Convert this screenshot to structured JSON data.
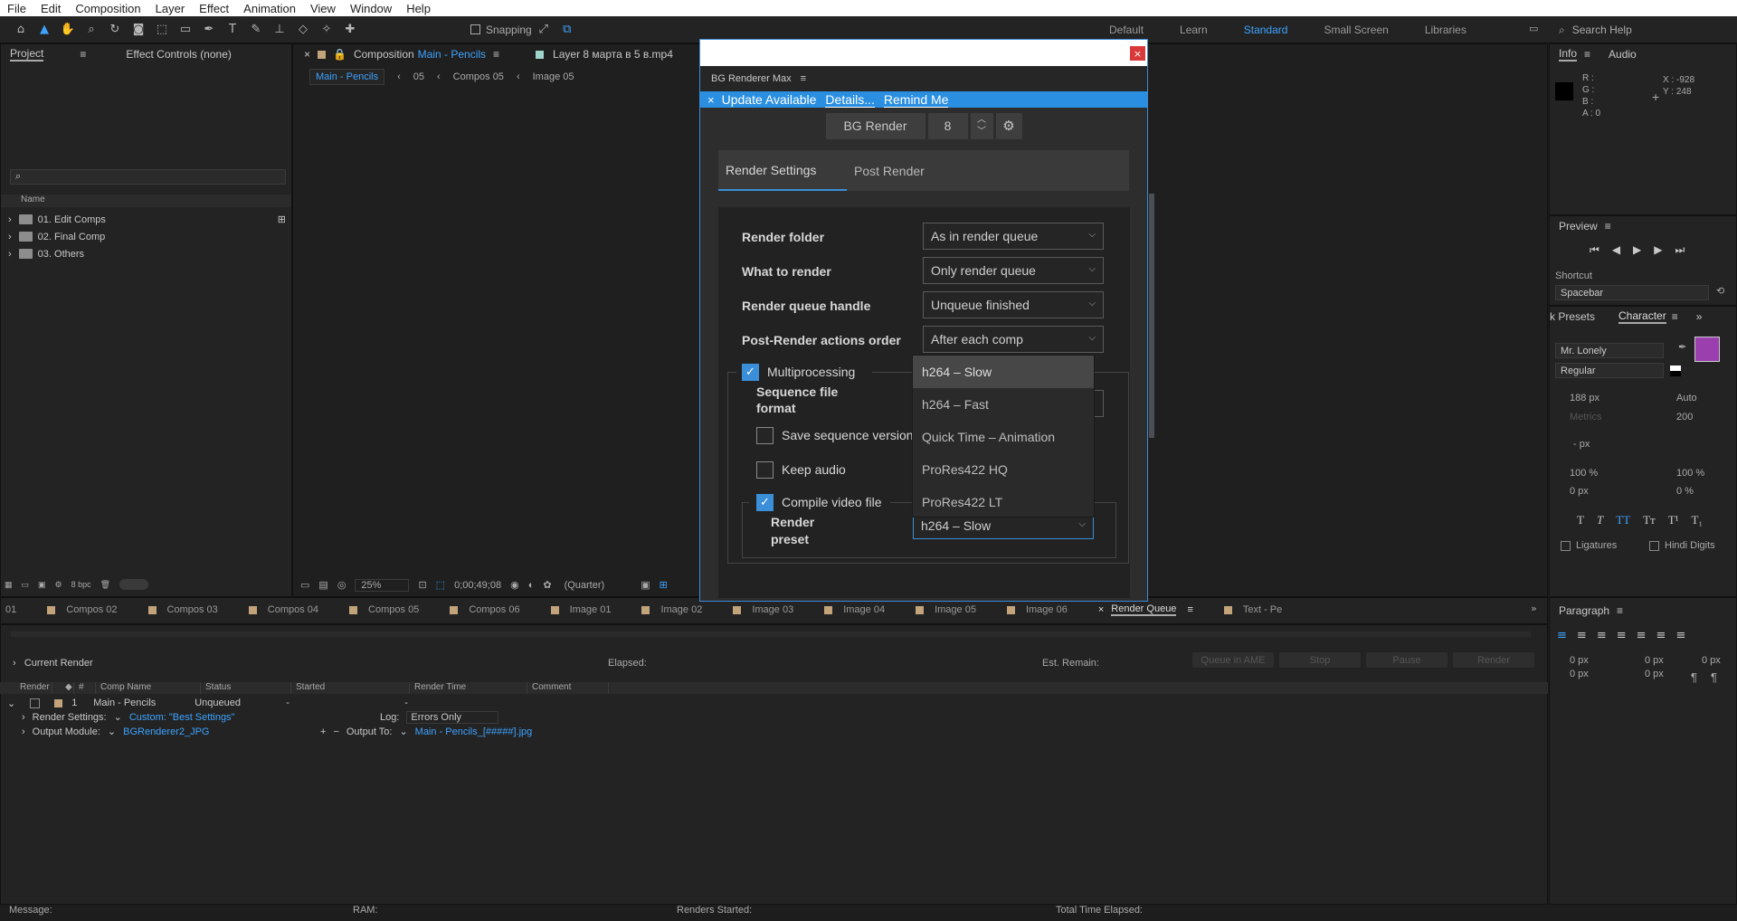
{
  "menu": [
    "File",
    "Edit",
    "Composition",
    "Layer",
    "Effect",
    "Animation",
    "View",
    "Window",
    "Help"
  ],
  "toolbar": {
    "snapping": "Snapping"
  },
  "workspaces": {
    "items": [
      "Default",
      "Learn",
      "Standard",
      "Small Screen",
      "Libraries"
    ],
    "selected": "Standard",
    "search_placeholder": "Search Help"
  },
  "project": {
    "tab_project": "Project",
    "tab_effect": "Effect Controls (none)",
    "search_placeholder": "",
    "col_name": "Name",
    "folders": [
      "01. Edit Comps",
      "02. Final Comp",
      "03. Others"
    ],
    "bpc": "8 bpc"
  },
  "composition": {
    "tab_label": "Composition",
    "comp_name": "Main - Pencils",
    "layer_tab": "Layer  8 марта в 5 в.mp4",
    "crumbs": [
      "Main - Pencils",
      "05",
      "Compos 05",
      "Image 05"
    ],
    "zoom": "25%",
    "timecode": "0;00;49;08",
    "quality": "(Quarter)"
  },
  "dialog": {
    "title": "BG Renderer Max",
    "update": {
      "text": "Update Available",
      "details": "Details...",
      "remind": "Remind Me"
    },
    "bg_render": "BG Render",
    "count": "8",
    "tabs": [
      "Render Settings",
      "Post Render"
    ],
    "rows": [
      {
        "label": "Render folder",
        "value": "As in render queue"
      },
      {
        "label": "What to render",
        "value": "Only render queue"
      },
      {
        "label": "Render queue handle",
        "value": "Unqueue finished"
      },
      {
        "label": "Post-Render actions order",
        "value": "After each comp"
      }
    ],
    "multiprocessing": "Multiprocessing",
    "seq_format_1": "Sequence file",
    "seq_format_2": "format",
    "save_seq": "Save sequence version",
    "keep_audio": "Keep audio",
    "compile": "Compile video file",
    "render_preset_1": "Render",
    "render_preset_2": "preset",
    "preset_value": "h264 – Slow",
    "dropdown": [
      "h264 – Slow",
      "h264 – Fast",
      "Quick Time – Animation",
      "ProRes422 HQ",
      "ProRes422 LT"
    ]
  },
  "bottom_tabs": [
    "01",
    "Compos 02",
    "Compos 03",
    "Compos 04",
    "Compos 05",
    "Compos 06",
    "Image 01",
    "Image 02",
    "Image 03",
    "Image 04",
    "Image 05",
    "Image 06",
    "Render Queue",
    "Text - Pe"
  ],
  "render_queue": {
    "current_render": "Current Render",
    "elapsed": "Elapsed:",
    "est_remain": "Est. Remain:",
    "buttons": [
      "Queue in AME",
      "Stop",
      "Pause",
      "Render"
    ],
    "headers": [
      "Render",
      "#",
      "Comp Name",
      "Status",
      "Started",
      "Render Time",
      "Comment"
    ],
    "item": {
      "num": "1",
      "comp": "Main - Pencils",
      "status": "Unqueued",
      "started": "-",
      "render_time": "-"
    },
    "render_settings_label": "Render Settings:",
    "render_settings_value": "Custom: \"Best Settings\"",
    "log_label": "Log:",
    "log_value": "Errors Only",
    "output_module_label": "Output Module:",
    "output_module_value": "BGRenderer2_JPG",
    "output_to_label": "Output To:",
    "output_to_value": "Main - Pencils_[#####].jpg"
  },
  "status_bar": {
    "message": "Message:",
    "ram": "RAM:",
    "renders_started": "Renders Started:",
    "total_time": "Total Time Elapsed:"
  },
  "info": {
    "tab_info": "Info",
    "tab_audio": "Audio",
    "r": "R :",
    "g": "G :",
    "b": "B :",
    "a": "A :  0",
    "x": "X : -928",
    "y": "Y : 248"
  },
  "preview": {
    "title": "Preview",
    "shortcut_label": "Shortcut",
    "shortcut_value": "Spacebar"
  },
  "character": {
    "tab_presets": "k Presets",
    "tab_character": "Character",
    "font": "Mr. Lonely",
    "style": "Regular",
    "size": "188 px",
    "leading": "Auto",
    "kerning": "Metrics",
    "tracking": "200",
    "stroke": "- px",
    "vscale": "100 %",
    "hscale": "100 %",
    "baseline": "0 px",
    "tsume": "0 %",
    "ligatures": "Ligatures",
    "hindi": "Hindi Digits",
    "fill_color": "#9b3fae"
  },
  "paragraph": {
    "title": "Paragraph",
    "v1": "0 px",
    "v2": "0 px",
    "v3": "0 px",
    "v4": "0 px",
    "v5": "0 px"
  }
}
